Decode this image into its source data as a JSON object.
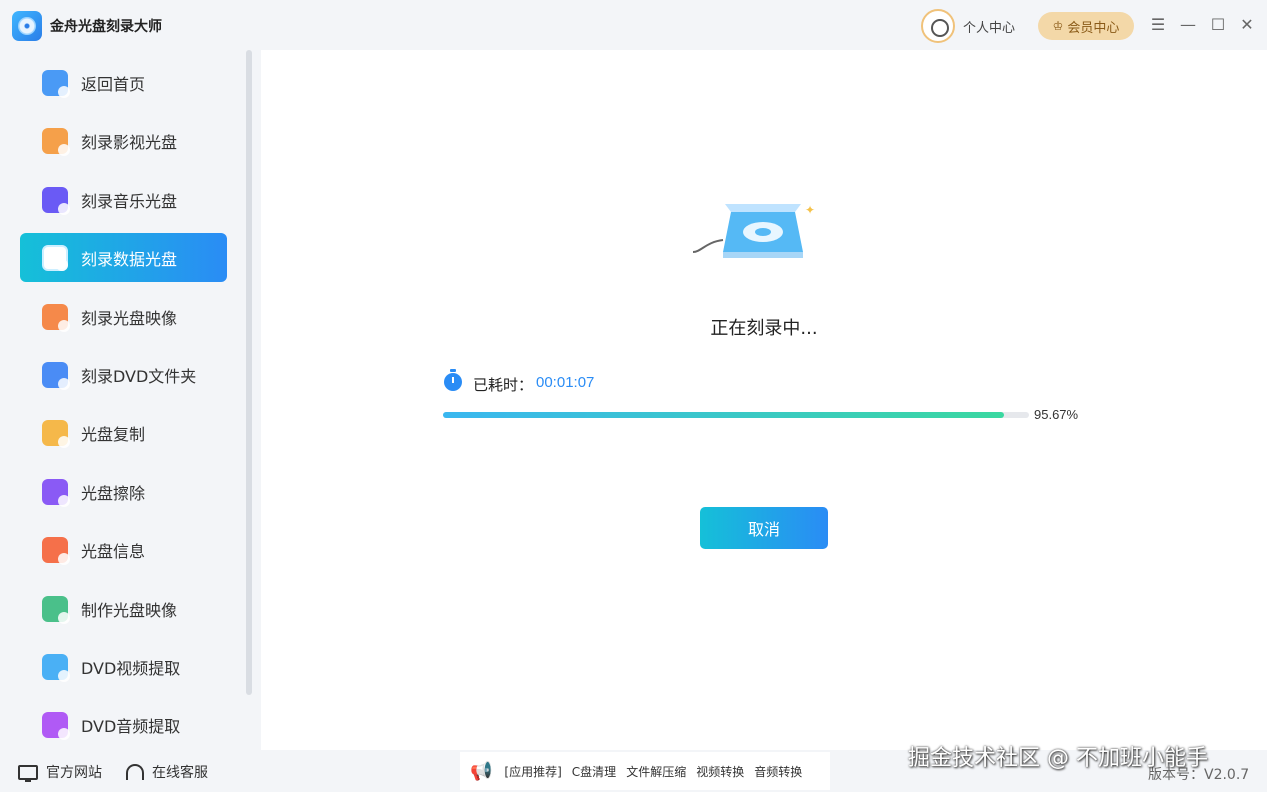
{
  "app": {
    "title": "金舟光盘刻录大师"
  },
  "header": {
    "user_center": "个人中心",
    "vip_center": "会员中心",
    "controls": [
      "menu-icon",
      "minimize-icon",
      "maximize-icon",
      "close-icon"
    ]
  },
  "sidebar": {
    "items": [
      {
        "label": "返回首页",
        "icon": "home-icon",
        "color": "#4a9af5"
      },
      {
        "label": "刻录影视光盘",
        "icon": "video-disc-icon",
        "color": "#f5a04a"
      },
      {
        "label": "刻录音乐光盘",
        "icon": "music-disc-icon",
        "color": "#6a5af5"
      },
      {
        "label": "刻录数据光盘",
        "icon": "data-disc-icon",
        "color": "#ffffff",
        "active": true
      },
      {
        "label": "刻录光盘映像",
        "icon": "disc-image-icon",
        "color": "#f5894a"
      },
      {
        "label": "刻录DVD文件夹",
        "icon": "dvd-folder-icon",
        "color": "#4a8cf5"
      },
      {
        "label": "光盘复制",
        "icon": "disc-copy-icon",
        "color": "#f5b84a"
      },
      {
        "label": "光盘擦除",
        "icon": "disc-erase-icon",
        "color": "#8a5af5"
      },
      {
        "label": "光盘信息",
        "icon": "disc-info-icon",
        "color": "#f5704a"
      },
      {
        "label": "制作光盘映像",
        "icon": "make-image-icon",
        "color": "#4ac08a"
      },
      {
        "label": "DVD视频提取",
        "icon": "dvd-video-extract-icon",
        "color": "#4ab0f5"
      },
      {
        "label": "DVD音频提取",
        "icon": "dvd-audio-extract-icon",
        "color": "#b05af5"
      }
    ]
  },
  "main": {
    "status": "正在刻录中...",
    "elapsed_label": "已耗时：",
    "elapsed_value": "00:01:07",
    "progress": 95.67,
    "progress_text": "95.67%",
    "cancel_label": "取消"
  },
  "footer": {
    "website": "官方网站",
    "support": "在线客服",
    "tools": [
      "[应用推荐]",
      "C盘清理",
      "文件解压缩",
      "视频转换",
      "音频转换"
    ],
    "version": "版本号：V2.0.7",
    "watermark": "掘金技术社区 @ 不加班小能手"
  }
}
